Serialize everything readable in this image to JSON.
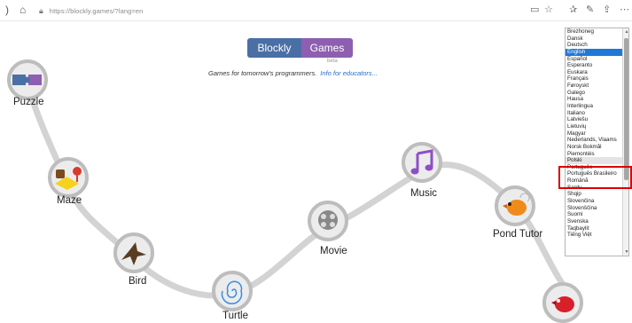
{
  "browser": {
    "url": "https://blockly.games/?lang=en"
  },
  "header": {
    "logo_left": "Blockly",
    "logo_right": "Games",
    "beta": "beta",
    "tagline": "Games for tomorrow's programmers.",
    "educators_link": "Info for educators..."
  },
  "games": [
    {
      "label": "Puzzle"
    },
    {
      "label": "Maze"
    },
    {
      "label": "Bird"
    },
    {
      "label": "Turtle"
    },
    {
      "label": "Movie"
    },
    {
      "label": "Music"
    },
    {
      "label": "Pond Tutor"
    },
    {
      "label": ""
    }
  ],
  "languages": {
    "items": [
      "Brezhoneg",
      "Dansk",
      "Deutsch",
      "English",
      "Español",
      "Esperanto",
      "Euskara",
      "Français",
      "Føroyskt",
      "Galego",
      "Hausa",
      "Interlingua",
      "Italiano",
      "Latviešu",
      "Lietuvių",
      "Magyar",
      "Nederlands, Vlaams",
      "Norsk Bokmål",
      "Piemontèis",
      "Polski",
      "Português",
      "Português Brasileiro",
      "Română",
      "Sardu",
      "Shqip",
      "Slovenčina",
      "Slovenščina",
      "Suomi",
      "Svenska",
      "Taqbaylit",
      "Tiếng Việt"
    ],
    "selected": "English",
    "hovered": "Polski"
  },
  "colors": {
    "accent": "#1e78d7",
    "highlight": "#dd0000",
    "logo_blue": "#4a6fa5",
    "logo_purple": "#8e5fb0"
  }
}
